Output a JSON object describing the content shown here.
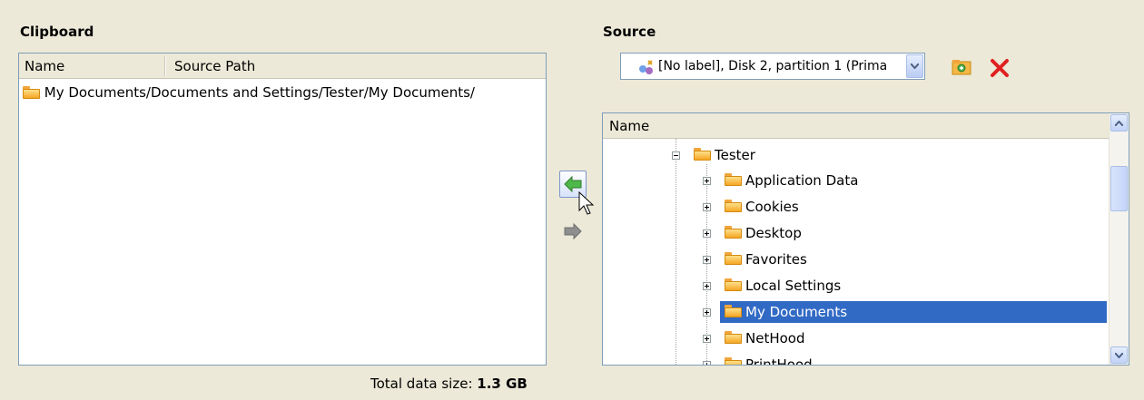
{
  "clipboard": {
    "title": "Clipboard",
    "columns": [
      "Name",
      "Source Path"
    ],
    "rows": [
      {
        "name": "My Documents",
        "path": "/Documents and Settings/Tester/My Documents/"
      }
    ],
    "total_label": "Total data size:",
    "total_value": "1.3 GB"
  },
  "source": {
    "title": "Source",
    "selected_partition": "[No label], Disk 2, partition 1 (Prima",
    "tree_column": "Name",
    "tree": {
      "parent": "Tester",
      "children": [
        "Application Data",
        "Cookies",
        "Desktop",
        "Favorites",
        "Local Settings",
        "My Documents",
        "NetHood",
        "PrintHood"
      ],
      "selected": "My Documents"
    }
  },
  "icons": {
    "add_to_clipboard": "arrow-left-icon",
    "remove_from_clipboard": "arrow-right-icon",
    "new_folder": "new-folder-icon",
    "delete": "delete-x-icon"
  },
  "colors": {
    "selection": "#316AC5",
    "window_bg": "#ECE9D8",
    "border": "#7F9DB9"
  }
}
